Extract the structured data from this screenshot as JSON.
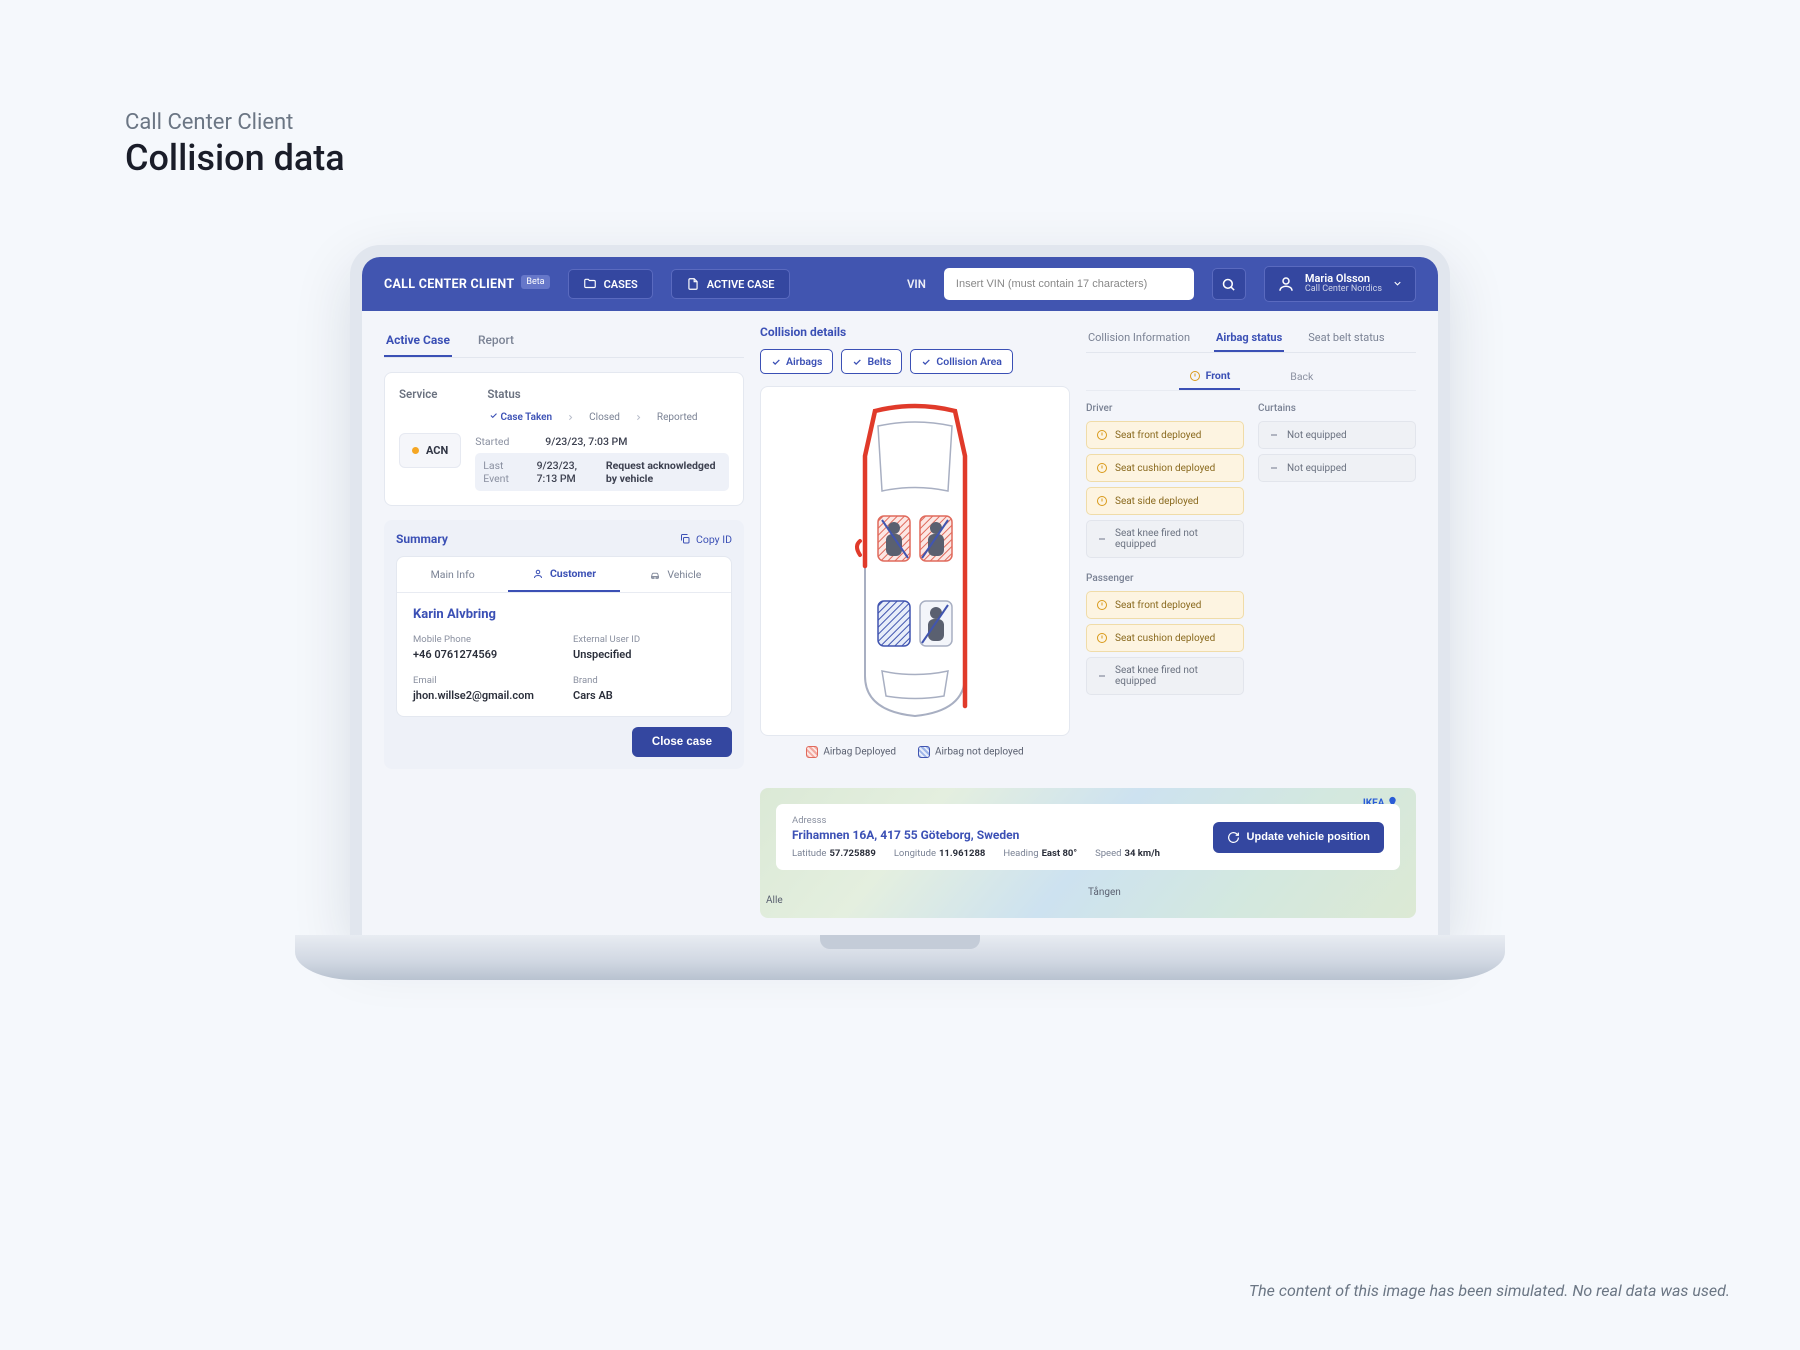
{
  "page": {
    "subtitle": "Call Center Client",
    "title": "Collision data"
  },
  "header": {
    "brand": "CALL CENTER CLIENT",
    "beta": "Beta",
    "nav": {
      "cases": "CASES",
      "active": "ACTIVE CASE"
    },
    "vin_label": "VIN",
    "vin_placeholder": "Insert VIN (must contain 17 characters)",
    "user": {
      "name": "Maria Olsson",
      "role": "Call Center Nordics"
    }
  },
  "left": {
    "tabs": {
      "active_case": "Active Case",
      "report": "Report"
    },
    "service_hdr": "Service",
    "status_hdr": "Status",
    "status_steps": {
      "taken": "Case Taken",
      "closed": "Closed",
      "reported": "Reported"
    },
    "service_code": "ACN",
    "started_lbl": "Started",
    "started_val": "9/23/23, 7:03 PM",
    "last_lbl": "Last Event",
    "last_time": "9/23/23, 7:13 PM",
    "last_text": "Request acknowledged by vehicle",
    "summary_title": "Summary",
    "copy_id": "Copy ID",
    "mini_tabs": {
      "main": "Main Info",
      "customer": "Customer",
      "vehicle": "Vehicle"
    },
    "customer": {
      "name": "Karin Alvbring",
      "phone_lbl": "Mobile Phone",
      "phone": "+46 0761274569",
      "ext_lbl": "External User ID",
      "ext": "Unspecified",
      "email_lbl": "Email",
      "email": "jhon.willse2@gmail.com",
      "brand_lbl": "Brand",
      "brand": "Cars AB"
    },
    "close_case": "Close case"
  },
  "collision": {
    "title": "Collision details",
    "filters": {
      "airbags": "Airbags",
      "belts": "Belts",
      "area": "Collision Area"
    },
    "legend": {
      "deployed": "Airbag Deployed",
      "not": "Airbag not deployed"
    }
  },
  "airbag": {
    "tabs": {
      "info": "Collision Information",
      "airbag": "Airbag status",
      "belt": "Seat belt status"
    },
    "fb": {
      "front": "Front",
      "back": "Back"
    },
    "driver_hdr": "Driver",
    "curtains_hdr": "Curtains",
    "passenger_hdr": "Passenger",
    "driver": [
      {
        "t": "Seat front deployed",
        "s": "deployed"
      },
      {
        "t": "Seat cushion deployed",
        "s": "deployed"
      },
      {
        "t": "Seat side deployed",
        "s": "deployed"
      },
      {
        "t": "Seat knee fired not equipped",
        "s": "neutral"
      }
    ],
    "curtains": [
      {
        "t": "Not equipped",
        "s": "neutral"
      },
      {
        "t": "Not equipped",
        "s": "neutral"
      }
    ],
    "passenger": [
      {
        "t": "Seat front deployed",
        "s": "deployed"
      },
      {
        "t": "Seat cushion deployed",
        "s": "deployed"
      },
      {
        "t": "Seat knee fired not equipped",
        "s": "neutral"
      }
    ]
  },
  "map": {
    "addr_lbl": "Adresss",
    "address": "Frihamnen 16A, 417 55 Göteborg, Sweden",
    "lat_lbl": "Latitude",
    "lat": "57.725889",
    "lon_lbl": "Longitude",
    "lon": "11.961288",
    "head_lbl": "Heading",
    "head": "East 80°",
    "speed_lbl": "Speed",
    "speed": "34 km/h",
    "update": "Update vehicle position",
    "labels": {
      "ikea": "IKEA",
      "tangen": "Tången",
      "alle": "Alle"
    }
  },
  "disclaimer": "The content of this image has been simulated. No real data was used."
}
